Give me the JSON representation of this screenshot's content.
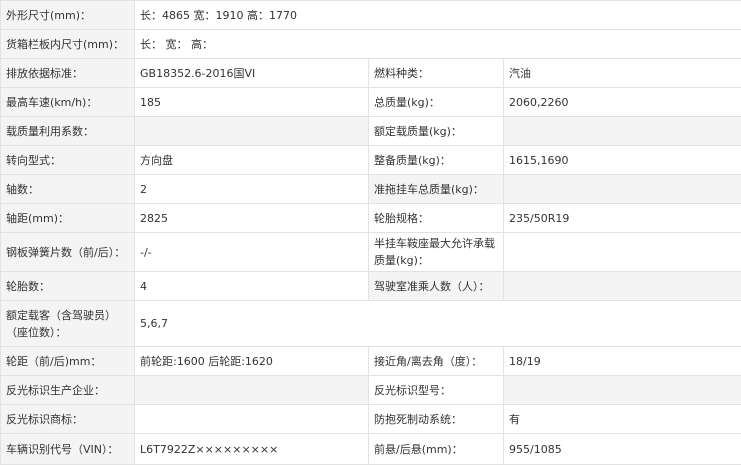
{
  "rows": [
    {
      "l1": "外形尺寸(mm)：",
      "v1": "长：4865 宽：1910 高：1770"
    },
    {
      "l1": "货箱栏板内尺寸(mm)：",
      "v1": "长： 宽： 高："
    },
    {
      "l1": "排放依据标准：",
      "v1": "GB18352.6-2016国VI",
      "l2": "燃料种类：",
      "v2": "汽油"
    },
    {
      "l1": "最高车速(km/h)：",
      "v1": "185",
      "l2": "总质量(kg)：",
      "v2": "2060,2260"
    },
    {
      "l1": "载质量利用系数：",
      "v1": "",
      "l2": "额定载质量(kg)：",
      "v2": ""
    },
    {
      "l1": "转向型式：",
      "v1": "方向盘",
      "l2": "整备质量(kg)：",
      "v2": "1615,1690"
    },
    {
      "l1": "轴数：",
      "v1": "2",
      "l2": "准拖挂车总质量(kg)：",
      "v2": ""
    },
    {
      "l1": "轴距(mm)：",
      "v1": "2825",
      "l2": "轮胎规格：",
      "v2": "235/50R19"
    },
    {
      "l1": "钢板弹簧片数（前/后）：",
      "v1": "-/-",
      "l2": "半挂车鞍座最大允许承载质量(kg)：",
      "v2": ""
    },
    {
      "l1": "轮胎数：",
      "v1": "4",
      "l2": "驾驶室准乘人数（人）：",
      "v2": ""
    },
    {
      "l1": "额定载客（含驾驶员）（座位数）：",
      "v1": "5,6,7"
    },
    {
      "l1": "轮距（前/后)mm：",
      "v1": "前轮距:1600 后轮距:1620",
      "l2": "接近角/离去角（度）：",
      "v2": "18/19"
    },
    {
      "l1": "反光标识生产企业：",
      "v1": "",
      "l2": "反光标识型号：",
      "v2": ""
    },
    {
      "l1": "反光标识商标：",
      "v1": "",
      "l2": "防抱死制动系统：",
      "v2": "有"
    },
    {
      "l1": "车辆识别代号（VIN）：",
      "v1": "L6T7922Z×××××××××",
      "l2": "前悬/后悬(mm)：",
      "v2": "955/1085"
    }
  ]
}
